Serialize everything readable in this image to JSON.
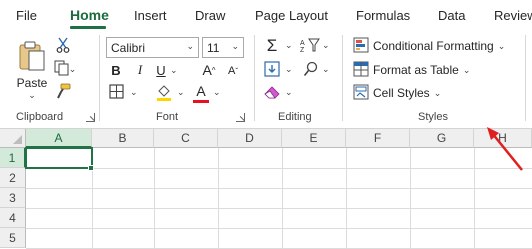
{
  "tabs": [
    "File",
    "Home",
    "Insert",
    "Draw",
    "Page Layout",
    "Formulas",
    "Data",
    "Review"
  ],
  "active_tab": "Home",
  "clipboard": {
    "paste_label": "Paste",
    "group_label": "Clipboard"
  },
  "font": {
    "font_name": "Calibri",
    "font_size": "11",
    "group_label": "Font",
    "bold": "B",
    "italic": "I",
    "underline": "U",
    "grow": "A",
    "shrink": "A",
    "font_color_letter": "A",
    "font_color": "#e81123",
    "highlight_color": "#ffd500"
  },
  "editing": {
    "group_label": "Editing"
  },
  "styles": {
    "conditional_formatting": "Conditional Formatting",
    "format_as_table": "Format as Table",
    "cell_styles": "Cell Styles",
    "group_label": "Styles"
  },
  "grid": {
    "columns": [
      "A",
      "B",
      "C",
      "D",
      "E",
      "F",
      "G",
      "H"
    ],
    "rows": [
      "1",
      "2",
      "3",
      "4",
      "5"
    ],
    "selected_cell": "A1"
  },
  "colors": {
    "accent": "#217346",
    "annotation_arrow": "#e02020"
  }
}
